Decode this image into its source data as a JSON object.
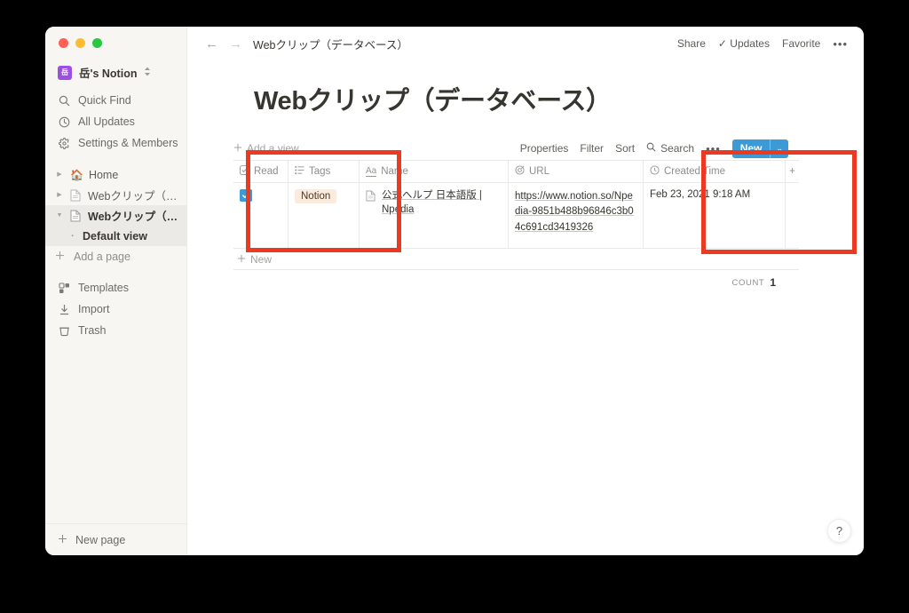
{
  "window": {
    "traffic_lights": [
      "close",
      "minimize",
      "zoom"
    ],
    "colors": {
      "accent_blue": "#3c9ad6",
      "tag_bg": "#faebdd",
      "annotation_red": "#ec3a22",
      "workspace_avatar": "#9b51e0"
    }
  },
  "sidebar": {
    "workspace": {
      "name": "岳's Notion",
      "avatar_initial": "岳",
      "chevron": "⌃⌄"
    },
    "nav": [
      {
        "label": "Quick Find",
        "icon": "search-icon"
      },
      {
        "label": "All Updates",
        "icon": "clock-icon"
      },
      {
        "label": "Settings & Members",
        "icon": "gear-icon"
      }
    ],
    "tree": [
      {
        "label": "Home",
        "icon": "house-emoji",
        "twisty": "▶",
        "type": "emoji",
        "active": false
      },
      {
        "label": "Webクリップ（ペ...",
        "icon": "page-icon",
        "twisty": "▶",
        "type": "page",
        "active": false
      },
      {
        "label": "Webクリップ（デ...",
        "icon": "page-icon",
        "twisty": "▼",
        "type": "page",
        "active": true
      },
      {
        "label": "Default view",
        "icon": "bullet",
        "twisty": "",
        "type": "child",
        "active": true
      }
    ],
    "add_page": {
      "label": "Add a page",
      "icon": "plus-icon"
    },
    "utilities": [
      {
        "label": "Templates",
        "icon": "templates-icon"
      },
      {
        "label": "Import",
        "icon": "import-icon"
      },
      {
        "label": "Trash",
        "icon": "trash-icon"
      }
    ],
    "new_page": {
      "label": "New page",
      "icon": "plus-icon"
    }
  },
  "topbar": {
    "back": "←",
    "forward": "→",
    "breadcrumb": "Webクリップ（データベース）",
    "share": "Share",
    "updates": "Updates",
    "favorite": "Favorite",
    "more": "•••"
  },
  "page": {
    "title": "Webクリップ（データベース）"
  },
  "viewbar": {
    "add_view": "Add a view",
    "properties": "Properties",
    "filter": "Filter",
    "sort": "Sort",
    "search": "Search",
    "more": "•••",
    "new_button": "New",
    "new_chevron": "⌄"
  },
  "table": {
    "columns": [
      {
        "label": "Read",
        "icon": "checkbox-property-icon"
      },
      {
        "label": "Tags",
        "icon": "multiselect-property-icon"
      },
      {
        "label": "Name",
        "icon": "title-property-icon"
      },
      {
        "label": "URL",
        "icon": "url-property-icon"
      },
      {
        "label": "Created Time",
        "icon": "clock-property-icon"
      }
    ],
    "add_column": "+",
    "rows": [
      {
        "read": true,
        "tags": [
          "Notion"
        ],
        "name": "公式ヘルプ 日本語版 | Npedia",
        "url": "https://www.notion.so/Npedia-9851b488b96846c3b04c691cd3419326",
        "created_time": "Feb 23, 2021 9:18 AM"
      }
    ],
    "add_row": "New",
    "count_label": "COUNT",
    "count_value": "1"
  },
  "help": {
    "label": "?"
  }
}
